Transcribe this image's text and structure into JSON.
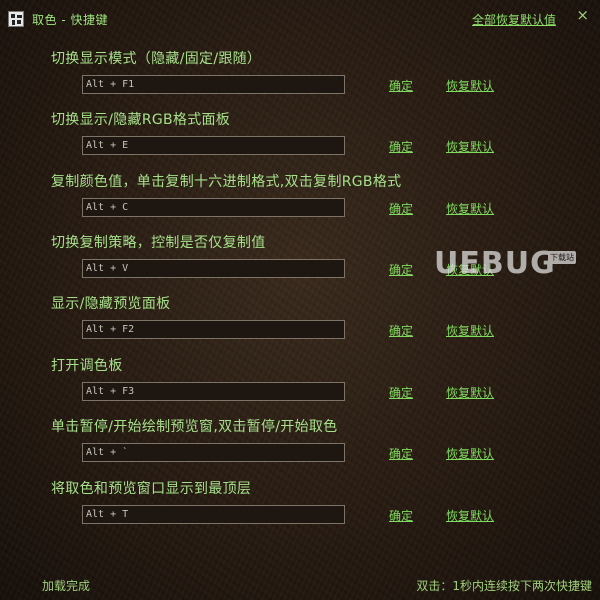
{
  "window": {
    "title": "取色 - 快捷键",
    "reset_all_label": "全部恢复默认值",
    "close_glyph": "×"
  },
  "buttons": {
    "ok_label": "确定",
    "reset_label": "恢复默认"
  },
  "rows": [
    {
      "label": "切换显示模式（隐藏/固定/跟随）",
      "key": "Alt + F1"
    },
    {
      "label": "切换显示/隐藏RGB格式面板",
      "key": "Alt + E"
    },
    {
      "label": "复制颜色值，单击复制十六进制格式,双击复制RGB格式",
      "key": "Alt + C"
    },
    {
      "label": "切换复制策略，控制是否仅复制值",
      "key": "Alt + V"
    },
    {
      "label": "显示/隐藏预览面板",
      "key": "Alt + F2"
    },
    {
      "label": "打开调色板",
      "key": "Alt + F3"
    },
    {
      "label": "单击暂停/开始绘制预览窗,双击暂停/开始取色",
      "key": "Alt + `"
    },
    {
      "label": "将取色和预览窗口显示到最顶层",
      "key": "Alt + T"
    }
  ],
  "footer": {
    "status": "加载完成",
    "hint": "双击：1秒内连续按下两次快捷键"
  },
  "watermark": {
    "text": "UEBUG",
    "badge": "下载站"
  },
  "icons": {
    "app_icon": "app-logo-icon",
    "close_icon": "close-icon"
  },
  "colors": {
    "accent_text": "#a6e08a",
    "link": "#7fdc5e",
    "background": "#2a1d13",
    "input_border": "#7d7367"
  }
}
